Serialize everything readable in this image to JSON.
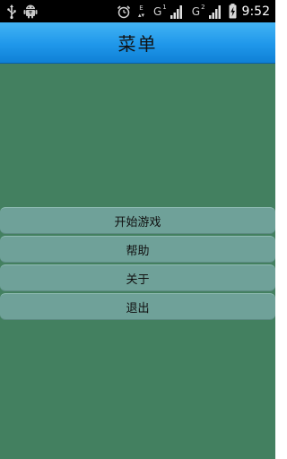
{
  "status_bar": {
    "left_icons": [
      "usb-icon",
      "android-debug-icon"
    ],
    "alarm_icon": "alarm-clock-icon",
    "data_badge": "E",
    "sim1": {
      "network": "G",
      "sim": "1"
    },
    "sim2": {
      "network": "G",
      "sim": "2"
    },
    "battery_icon": "battery-charging-icon",
    "time": "9:52"
  },
  "header": {
    "title": "菜单"
  },
  "menu": {
    "items": [
      {
        "label": "开始游戏"
      },
      {
        "label": "帮助"
      },
      {
        "label": "关于"
      },
      {
        "label": "退出"
      }
    ]
  },
  "colors": {
    "background": "#438060",
    "title_bar": "#1f97ea",
    "button": "#6fa199"
  }
}
